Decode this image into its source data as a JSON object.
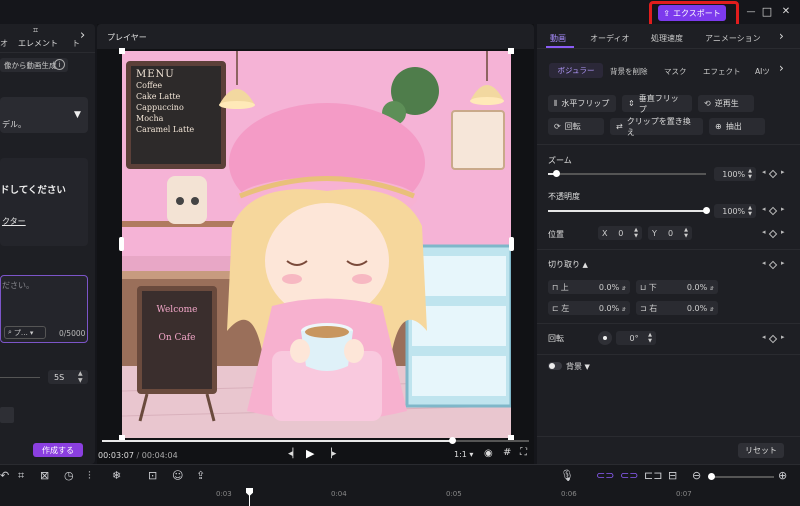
{
  "window": {
    "export_label": "エクスポート",
    "min": "—",
    "max": "□",
    "close": "✕"
  },
  "left_panel": {
    "tab_a": "オ",
    "tab_elements": "エレメント",
    "tab_c": "ト",
    "image_to_video": "像から動画生成",
    "model_text": "デル。",
    "upload_title": "ドしてください",
    "upload_link": "クター",
    "prompt_placeholder": "ださい。",
    "prompt_chip": "プ…",
    "char_count": "0/5000",
    "duration": "5S",
    "create_button": "作成する"
  },
  "player": {
    "title": "プレイヤー",
    "time_current": "00:03:07",
    "time_separator": "/",
    "time_total": "00:04:04",
    "ratio": "1:1",
    "progress": 0.82,
    "menu_board": [
      "MENU",
      "Coffee",
      "Cake Latte",
      "Cappuccino",
      "Mocha",
      "Caramel Latte"
    ],
    "sign_text": [
      "Welcome",
      "On Cafe"
    ]
  },
  "right_panel": {
    "tabs": [
      "動画",
      "オーディオ",
      "処理速度",
      "アニメーション"
    ],
    "active_tab": "動画",
    "sub_tabs": [
      "ボジュラー",
      "背景を削除",
      "マスク",
      "エフェクト",
      "AIツ"
    ],
    "active_sub_tab": "ボジュラー",
    "btn_hflip": "水平フリップ",
    "btn_vflip": "垂直フリップ",
    "btn_reverse": "逆再生",
    "btn_rotate": "回転",
    "btn_replace": "クリップを置き換え",
    "btn_extract": "抽出",
    "zoom_label": "ズーム",
    "zoom_value": "100%",
    "zoom_level": 0.05,
    "opacity_label": "不透明度",
    "opacity_value": "100%",
    "opacity_level": 1.0,
    "position_label": "位置",
    "pos_x_label": "X",
    "pos_x_value": "0",
    "pos_y_label": "Y",
    "pos_y_value": "0",
    "crop_label": "切り取り",
    "crop_top_label": "上",
    "crop_top_value": "0.0%",
    "crop_bottom_label": "下",
    "crop_bottom_value": "0.0%",
    "crop_left_label": "左",
    "crop_left_value": "0.0%",
    "crop_right_label": "右",
    "crop_right_value": "0.0%",
    "rotate_label": "回転",
    "rotate_value": "0",
    "rotate_unit": "°",
    "background_label": "背景",
    "reset_label": "リセット"
  },
  "timeline": {
    "ticks": [
      "0:03",
      "0:04",
      "0:05",
      "0:06",
      "0:07"
    ]
  },
  "colors": {
    "accent": "#7c3aed",
    "highlight_box": "#e11d1d",
    "create_button": "#8b3fe0"
  }
}
